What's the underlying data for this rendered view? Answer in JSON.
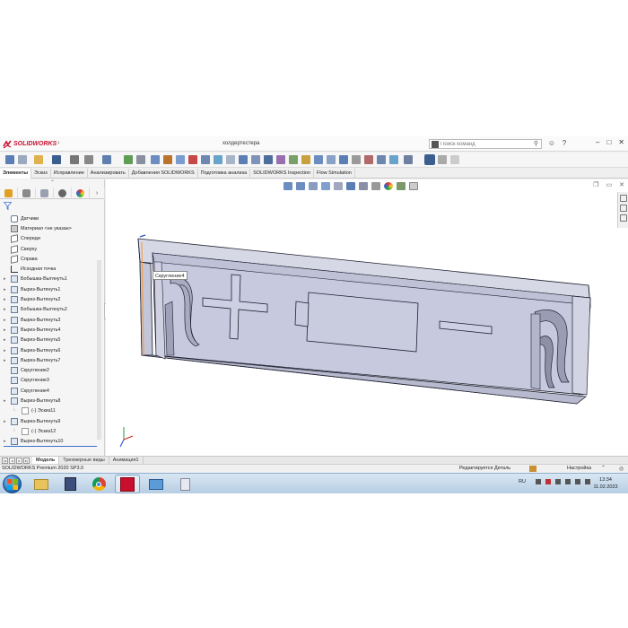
{
  "app": {
    "brand": "SOLIDWORKS",
    "document_title": "холдертестера",
    "search_placeholder": "Поиск команд"
  },
  "ribbon_tabs": [
    "Элементы",
    "Эскиз",
    "Исправление",
    "Анализировать",
    "Добавления SOLIDWORKS",
    "Подготовка анализа",
    "SOLIDWORKS Inspection",
    "Flow Simulation"
  ],
  "feature_tree": [
    {
      "label": "Датчики",
      "icon": "sensor-icon",
      "expandable": false,
      "indent": 0
    },
    {
      "label": "Материал <не указан>",
      "icon": "material-icon",
      "expandable": false,
      "indent": 0
    },
    {
      "label": "Спереди",
      "icon": "plane-icon",
      "expandable": false,
      "indent": 0
    },
    {
      "label": "Сверху",
      "icon": "plane-icon",
      "expandable": false,
      "indent": 0
    },
    {
      "label": "Справа",
      "icon": "plane-icon",
      "expandable": false,
      "indent": 0
    },
    {
      "label": "Исходная точка",
      "icon": "origin-icon",
      "expandable": false,
      "indent": 0
    },
    {
      "label": "Бобышка-Вытянуть1",
      "icon": "extrude-icon",
      "expandable": true,
      "indent": 0
    },
    {
      "label": "Вырез-Вытянуть1",
      "icon": "cut-extrude-icon",
      "expandable": true,
      "indent": 0
    },
    {
      "label": "Вырез-Вытянуть2",
      "icon": "cut-extrude-icon",
      "expandable": true,
      "indent": 0
    },
    {
      "label": "Бобышка-Вытянуть2",
      "icon": "extrude-icon",
      "expandable": true,
      "indent": 0
    },
    {
      "label": "Вырез-Вытянуть3",
      "icon": "cut-extrude-icon",
      "expandable": true,
      "indent": 0
    },
    {
      "label": "Вырез-Вытянуть4",
      "icon": "cut-extrude-icon",
      "expandable": true,
      "indent": 0
    },
    {
      "label": "Вырез-Вытянуть5",
      "icon": "cut-extrude-icon",
      "expandable": true,
      "indent": 0
    },
    {
      "label": "Вырез-Вытянуть6",
      "icon": "cut-extrude-icon",
      "expandable": true,
      "indent": 0
    },
    {
      "label": "Вырез-Вытянуть7",
      "icon": "cut-extrude-icon",
      "expandable": true,
      "indent": 0
    },
    {
      "label": "Скругление2",
      "icon": "fillet-icon",
      "expandable": false,
      "indent": 0
    },
    {
      "label": "Скругление3",
      "icon": "fillet-icon",
      "expandable": false,
      "indent": 0
    },
    {
      "label": "Скругление4",
      "icon": "fillet-icon",
      "expandable": false,
      "indent": 0
    },
    {
      "label": "Вырез-Вытянуть8",
      "icon": "cut-extrude-icon",
      "expandable": true,
      "indent": 0
    },
    {
      "label": "(-) Эскиз11",
      "icon": "sketch-icon",
      "expandable": false,
      "indent": 1
    },
    {
      "label": "Вырез-Вытянуть9",
      "icon": "cut-extrude-icon",
      "expandable": true,
      "indent": 0
    },
    {
      "label": "(-) Эскиз12",
      "icon": "sketch-icon",
      "expandable": false,
      "indent": 1
    },
    {
      "label": "Вырез-Вытянуть10",
      "icon": "cut-extrude-icon",
      "expandable": true,
      "indent": 0
    }
  ],
  "viewport": {
    "tooltip": "Скругление4"
  },
  "bottom_tabs": [
    "Модель",
    "Трехмерные виды",
    "Анимация1"
  ],
  "status": {
    "version": "SOLIDWORKS Premium 2020 SP3.0",
    "editing": "Редактируется Деталь",
    "units": "Настройка"
  },
  "taskbar": {
    "language": "RU",
    "time": "13:34",
    "date": "11.02.2023"
  },
  "colors": {
    "brand_red": "#c8102e",
    "model_face": "#c7c9df",
    "model_edge": "#1f2130",
    "selection_orange": "#f0a050"
  }
}
